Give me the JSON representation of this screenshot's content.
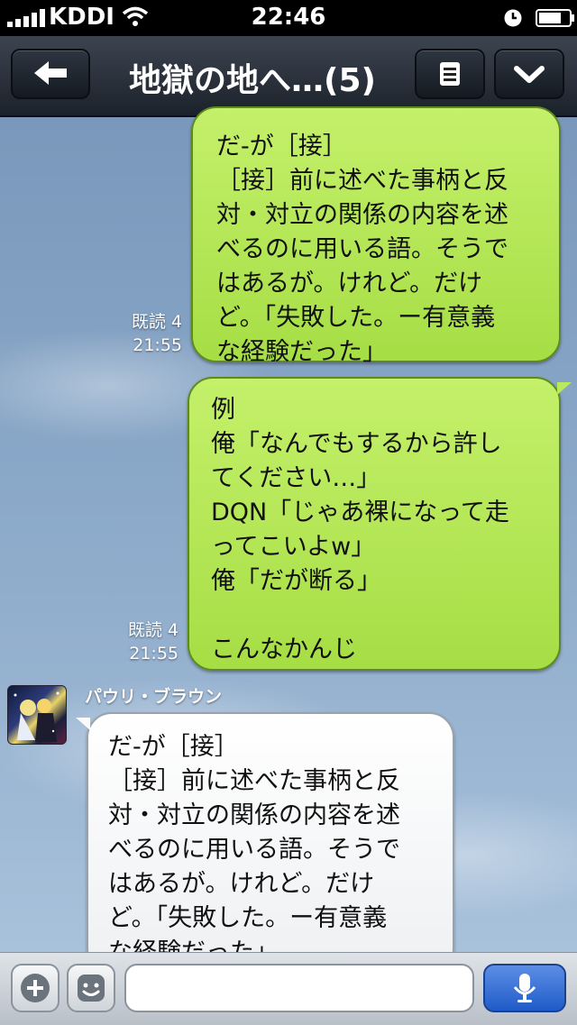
{
  "status_bar": {
    "carrier": "KDDI",
    "time": "22:46",
    "icons": [
      "signal-icon",
      "wifi-icon",
      "clock-icon",
      "battery-icon"
    ]
  },
  "header": {
    "title": "地獄の地へ…(5)",
    "back_icon": "back-arrow-icon",
    "menu_icon": "list-icon",
    "more_icon": "chevron-down-icon"
  },
  "messages": [
    {
      "side": "mine",
      "lines": [
        "だ-が［接］",
        "［接］前に述べた事柄と反",
        "対・対立の関係の内容を述",
        "べるのに用いる語。そうで",
        "はあるが。けれど。だけ",
        "ど。「失敗した。ー有意義",
        "な経験だった」"
      ],
      "read": "既読 4",
      "time": "21:55"
    },
    {
      "side": "mine",
      "lines": [
        "例",
        "俺「なんでもするから許し",
        "てください…」",
        "DQN「じゃあ裸になって走",
        "ってこいよw」",
        "俺「だが断る」",
        "",
        "こんなかんじ"
      ],
      "read": "既読 4",
      "time": "21:55"
    },
    {
      "side": "theirs",
      "sender": "パウリ・ブラウン",
      "lines": [
        "だ-が［接］",
        "［接］前に述べた事柄と反",
        "対・対立の関係の内容を述",
        "べるのに用いる語。そうで",
        "はあるが。けれど。だけ",
        "ど。「失敗した。ー有意義",
        "な経験だった」"
      ]
    }
  ],
  "input_bar": {
    "placeholder": "",
    "icons": [
      "plus-icon",
      "emoji-icon",
      "microphone-icon"
    ]
  },
  "colors": {
    "my_bubble": "#b4e653",
    "their_bubble": "#ffffff",
    "header": "#2a313b",
    "mic_button": "#2f6bd4"
  }
}
